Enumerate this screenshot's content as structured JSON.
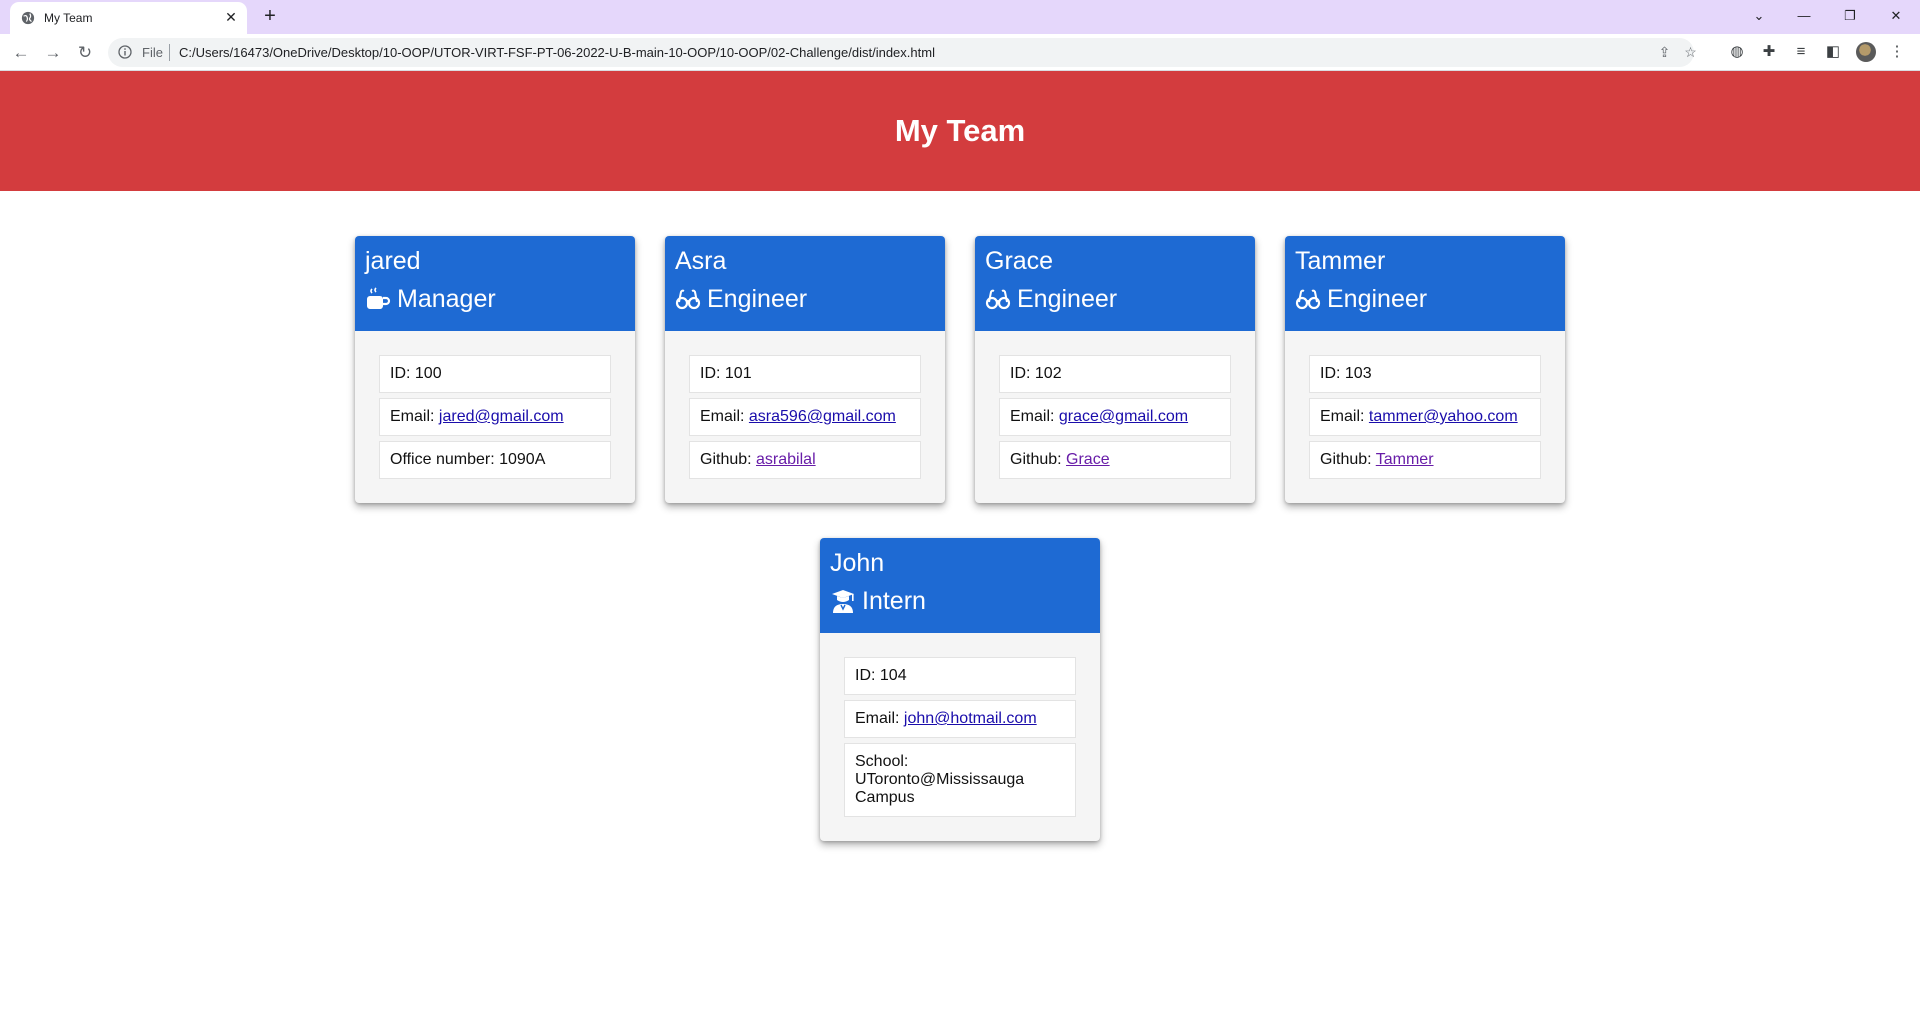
{
  "browser": {
    "tab_title": "My Team",
    "new_tab_label": "+",
    "omnibox_scheme": "File",
    "url": "C:/Users/16473/OneDrive/Desktop/10-OOP/UTOR-VIRT-FSF-PT-06-2022-U-B-main-10-OOP/10-OOP/02-Challenge/dist/index.html"
  },
  "page": {
    "title": "My Team",
    "header_color": "#d33c3e",
    "card_header_color": "#1e6ad3"
  },
  "members": [
    {
      "name": "jared",
      "role": "Manager",
      "icon": "mug-icon",
      "id_label": "ID: ",
      "id": "100",
      "email_label": "Email: ",
      "email": "jared@gmail.com",
      "extra_label": "Office number: ",
      "extra": "1090A"
    },
    {
      "name": "Asra",
      "role": "Engineer",
      "icon": "glasses-icon",
      "id_label": "ID: ",
      "id": "101",
      "email_label": "Email: ",
      "email": "asra596@gmail.com",
      "extra_label": "Github: ",
      "extra": "asrabilal"
    },
    {
      "name": "Grace",
      "role": "Engineer",
      "icon": "glasses-icon",
      "id_label": "ID: ",
      "id": "102",
      "email_label": "Email: ",
      "email": "grace@gmail.com",
      "extra_label": "Github: ",
      "extra": "Grace"
    },
    {
      "name": "Tammer",
      "role": "Engineer",
      "icon": "glasses-icon",
      "id_label": "ID: ",
      "id": "103",
      "email_label": "Email: ",
      "email": "tammer@yahoo.com",
      "extra_label": "Github: ",
      "extra": "Tammer"
    },
    {
      "name": "John",
      "role": "Intern",
      "icon": "graduate-icon",
      "id_label": "ID: ",
      "id": "104",
      "email_label": "Email: ",
      "email": "john@hotmail.com",
      "extra_label": "School: ",
      "extra": "UToronto@Mississauga Campus"
    }
  ]
}
